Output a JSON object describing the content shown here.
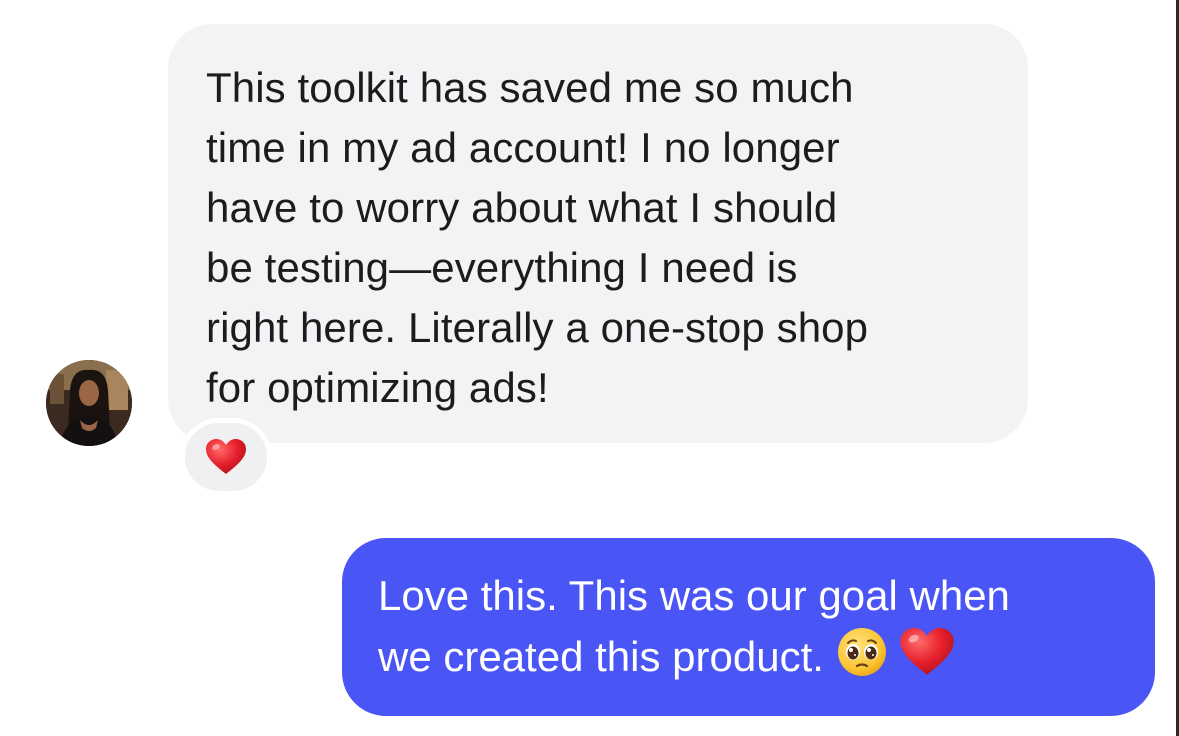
{
  "incoming": {
    "lines": [
      "This toolkit has saved me so much",
      "time in my ad account! I no longer",
      "have to worry about what I should",
      "be testing—everything I need is",
      "right here. Literally a one-stop shop",
      "for optimizing ads!"
    ],
    "reaction": "heart-emoji"
  },
  "outgoing": {
    "lines": [
      "Love this. This was our goal when",
      "we created this product."
    ],
    "emojis": [
      "pleading-face-emoji",
      "heart-emoji"
    ]
  },
  "colors": {
    "incoming_bubble": "#f2f3f5",
    "outgoing_bubble": "#4a55f5",
    "incoming_text": "#1c1c1e",
    "outgoing_text": "#ffffff",
    "heart": "#e8222e"
  }
}
